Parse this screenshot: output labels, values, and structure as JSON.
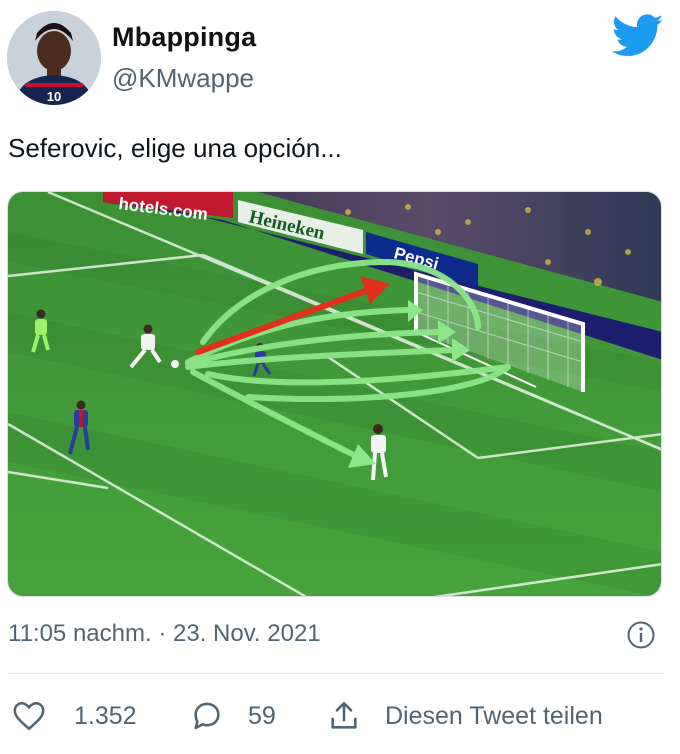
{
  "author": {
    "display_name": "Mbappinga",
    "handle": "@KMwappe",
    "avatar_icon": "profile-photo",
    "jersey_number": "10"
  },
  "platform_icon": "twitter-bird-icon",
  "tweet": {
    "text": "Seferovic, elige una opción..."
  },
  "media": {
    "type": "football-match-still-with-drawn-arrows",
    "ad_boards": [
      "hotels.com",
      "Heineken",
      "Pepsi"
    ]
  },
  "meta": {
    "timestamp": "11:05 nachm. · 23. Nov. 2021",
    "info_icon": "info-icon"
  },
  "actions": {
    "likes": "1.352",
    "replies": "59",
    "share_label": "Diesen Tweet teilen"
  },
  "colors": {
    "twitter_blue": "#1d9bf0",
    "text_secondary": "#536471",
    "pitch_green": "#3f9b3a",
    "arrow_green": "#8ee68a",
    "arrow_red": "#e0301e"
  }
}
